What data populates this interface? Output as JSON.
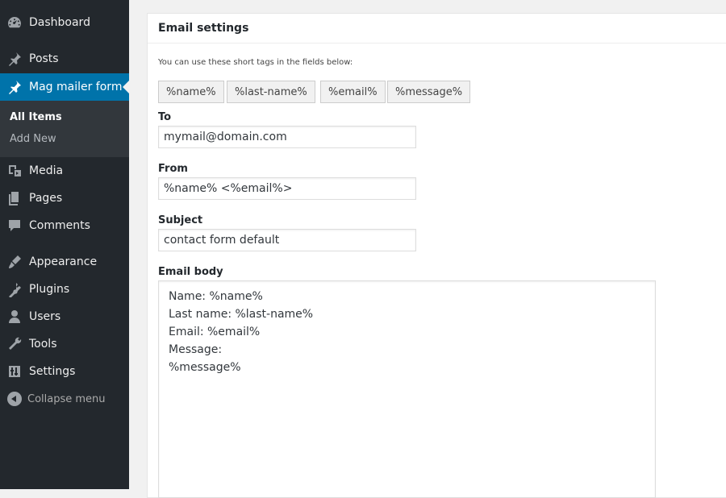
{
  "sidebar": {
    "items": [
      {
        "label": "Dashboard",
        "icon": "dashboard-icon"
      },
      {
        "label": "Posts",
        "icon": "pin-icon"
      },
      {
        "label": "Mag mailer form",
        "icon": "pin-icon"
      },
      {
        "label": "Media",
        "icon": "media-icon"
      },
      {
        "label": "Pages",
        "icon": "pages-icon"
      },
      {
        "label": "Comments",
        "icon": "comments-icon"
      },
      {
        "label": "Appearance",
        "icon": "appearance-icon"
      },
      {
        "label": "Plugins",
        "icon": "plugins-icon"
      },
      {
        "label": "Users",
        "icon": "users-icon"
      },
      {
        "label": "Tools",
        "icon": "tools-icon"
      },
      {
        "label": "Settings",
        "icon": "settings-icon"
      }
    ],
    "submenu": [
      {
        "label": "All Items"
      },
      {
        "label": "Add New"
      }
    ],
    "collapse_label": "Collapse menu",
    "active_color": "#0073aa"
  },
  "panel": {
    "title": "Email settings",
    "hint": "You can use these short tags in the fields below:",
    "tags": [
      "%name%",
      "%last-name%",
      "%email%",
      "%message%"
    ],
    "to_label": "To",
    "to_value": "mymail@domain.com",
    "from_label": "From",
    "from_value": "%name% <%email%>",
    "subject_label": "Subject",
    "subject_value": "contact form default",
    "body_label": "Email body",
    "body_value": "Name: %name%\nLast name: %last-name%\nEmail: %email%\nMessage:\n%message%"
  }
}
